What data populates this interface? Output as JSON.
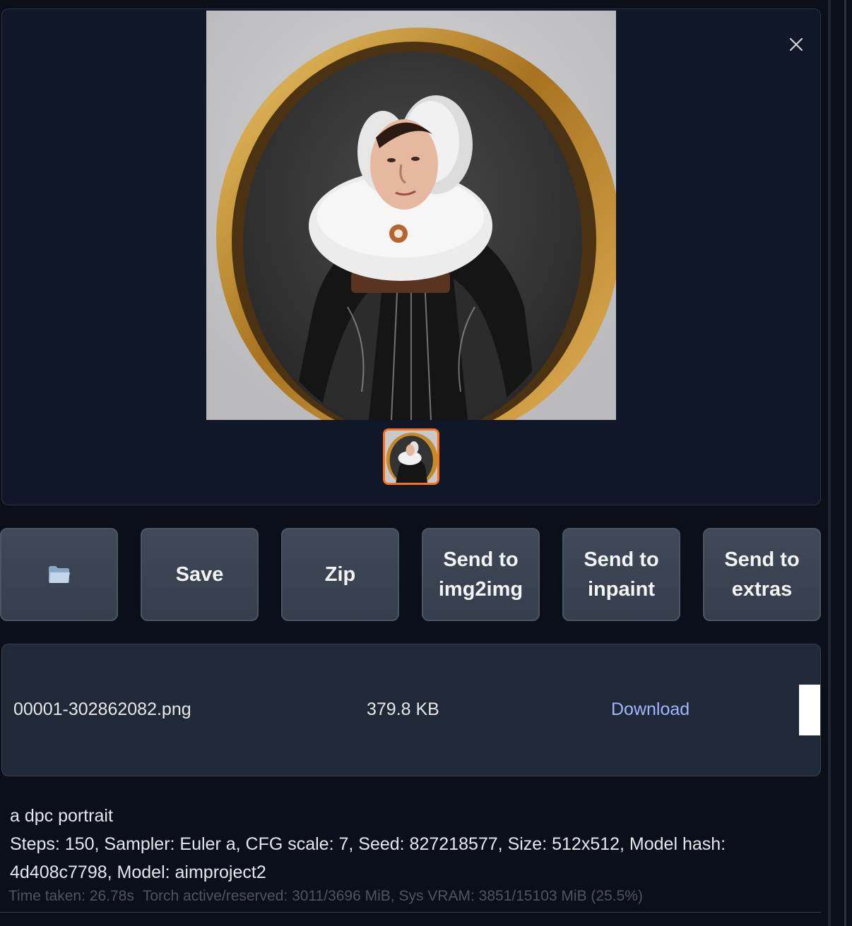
{
  "toolbar": {
    "buttons": [
      {
        "label": "",
        "icon": "folder-icon"
      },
      {
        "label": "Save"
      },
      {
        "label": "Zip"
      },
      {
        "label": "Send to img2img"
      },
      {
        "label": "Send to inpaint"
      },
      {
        "label": "Send to extras"
      }
    ]
  },
  "file": {
    "name": "00001-302862082.png",
    "size": "379.8 KB",
    "download_label": "Download"
  },
  "generation": {
    "prompt": "a dpc portrait",
    "params": "Steps: 150, Sampler: Euler a, CFG scale: 7, Seed: 827218577, Size: 512x512, Model hash: 4d408c7798, Model: aimproject2",
    "time_taken": "Time taken: 26.78s",
    "memory": "Torch active/reserved: 3011/3696 MiB, Sys VRAM: 3851/15103 MiB (25.5%)"
  },
  "colors": {
    "background": "#0b0f19",
    "button": "#374151",
    "accent_thumb_border": "#f97316",
    "link": "#a5b4fc"
  }
}
